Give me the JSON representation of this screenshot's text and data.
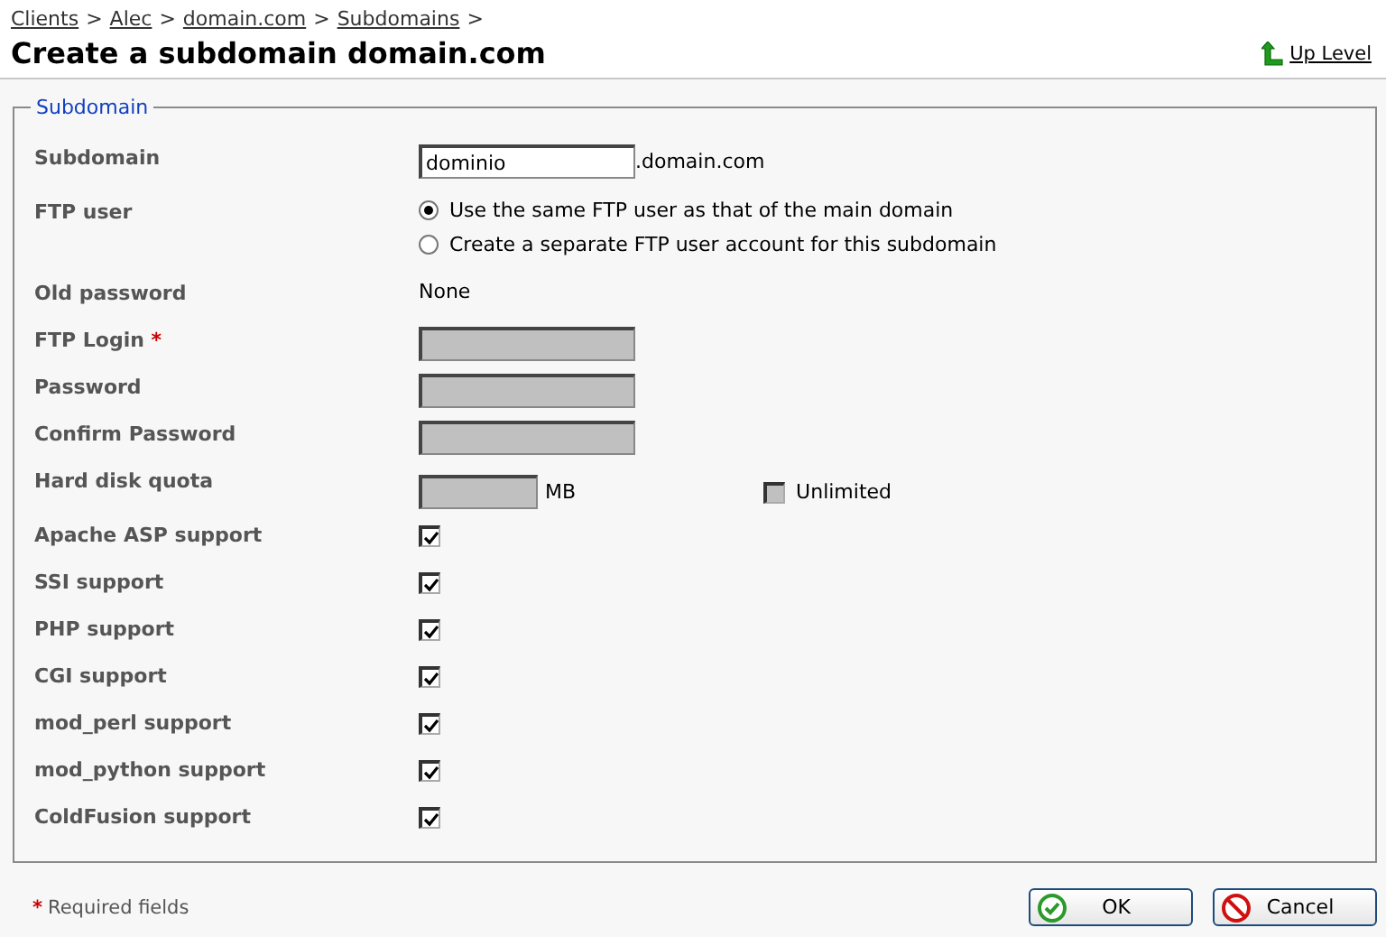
{
  "breadcrumb": [
    {
      "label": "Clients"
    },
    {
      "label": "Alec"
    },
    {
      "label": "domain.com"
    },
    {
      "label": "Subdomains"
    }
  ],
  "breadcrumb_separator": ">",
  "title": "Create a subdomain domain.com",
  "up_level": {
    "label": "Up Level"
  },
  "fieldset": {
    "legend": "Subdomain",
    "rows": [
      {
        "kind": "text",
        "label": "Subdomain",
        "value": "dominio",
        "suffix": ".domain.com",
        "disabled": false
      },
      {
        "kind": "radio",
        "label": "FTP user",
        "options": [
          {
            "label": "Use the same FTP user as that of the main domain",
            "selected": true
          },
          {
            "label": "Create a separate FTP user account for this subdomain",
            "selected": false
          }
        ]
      },
      {
        "kind": "static",
        "label": "Old password",
        "value": "None"
      },
      {
        "kind": "text",
        "label": "FTP Login",
        "required_mark": "*",
        "disabled": true
      },
      {
        "kind": "text",
        "label": "Password",
        "disabled": true
      },
      {
        "kind": "text",
        "label": "Confirm Password",
        "disabled": true
      },
      {
        "kind": "quota",
        "label": "Hard disk quota",
        "unit": "MB",
        "disabled": true,
        "unlimited": {
          "label": "Unlimited",
          "checked": false,
          "disabled": true
        }
      },
      {
        "kind": "checkbox",
        "label": "Apache ASP support",
        "checked": true
      },
      {
        "kind": "checkbox",
        "label": "SSI support",
        "checked": true
      },
      {
        "kind": "checkbox",
        "label": "PHP support",
        "checked": true
      },
      {
        "kind": "checkbox",
        "label": "CGI support",
        "checked": true
      },
      {
        "kind": "checkbox",
        "label": "mod_perl support",
        "checked": true
      },
      {
        "kind": "checkbox",
        "label": "mod_python support",
        "checked": true
      },
      {
        "kind": "checkbox",
        "label": "ColdFusion support",
        "checked": true
      }
    ]
  },
  "footer": {
    "required_mark": "*",
    "required_note": "Required fields",
    "buttons": [
      {
        "kind": "ok",
        "label": "OK"
      },
      {
        "kind": "cancel",
        "label": "Cancel"
      }
    ]
  }
}
